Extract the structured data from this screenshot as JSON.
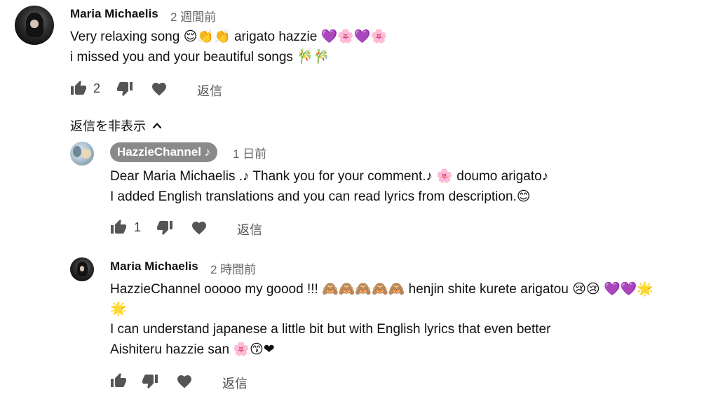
{
  "comment": {
    "author": "Maria Michaelis",
    "time": "2 週間前",
    "lines": [
      "Very relaxing song 😌👏👏 arigato hazzie 💜🌸💜🌸",
      "i missed you and your beautiful songs  🎋🎋"
    ],
    "likes": "2",
    "reply_label": "返信"
  },
  "toggle_replies_label": "返信を非表示",
  "replies": [
    {
      "author": "HazzieChannel ♪",
      "time": "1 日前",
      "lines": [
        "Dear Maria Michaelis .♪  Thank you for your comment.♪ 🌸 doumo arigato♪",
        "I added English translations and you can read lyrics from description.😊"
      ],
      "likes": "1",
      "reply_label": "返信"
    },
    {
      "author": "Maria Michaelis",
      "time": "2 時間前",
      "lines": [
        "HazzieChannel ooooo my goood !!! 🙈🙈🙈🙈🙈 henjin shite kurete arigatou 😢😢 💜💜🌟",
        "🌟",
        "I can understand japanese a little bit but with English lyrics that even better",
        "Aishiteru hazzie san 🌸😙❤"
      ],
      "likes": "",
      "reply_label": "返信"
    }
  ],
  "icons": {
    "like": "thumbs-up-icon",
    "dislike": "thumbs-down-icon",
    "heart": "heart-icon",
    "chevron": "chevron-up-icon"
  }
}
